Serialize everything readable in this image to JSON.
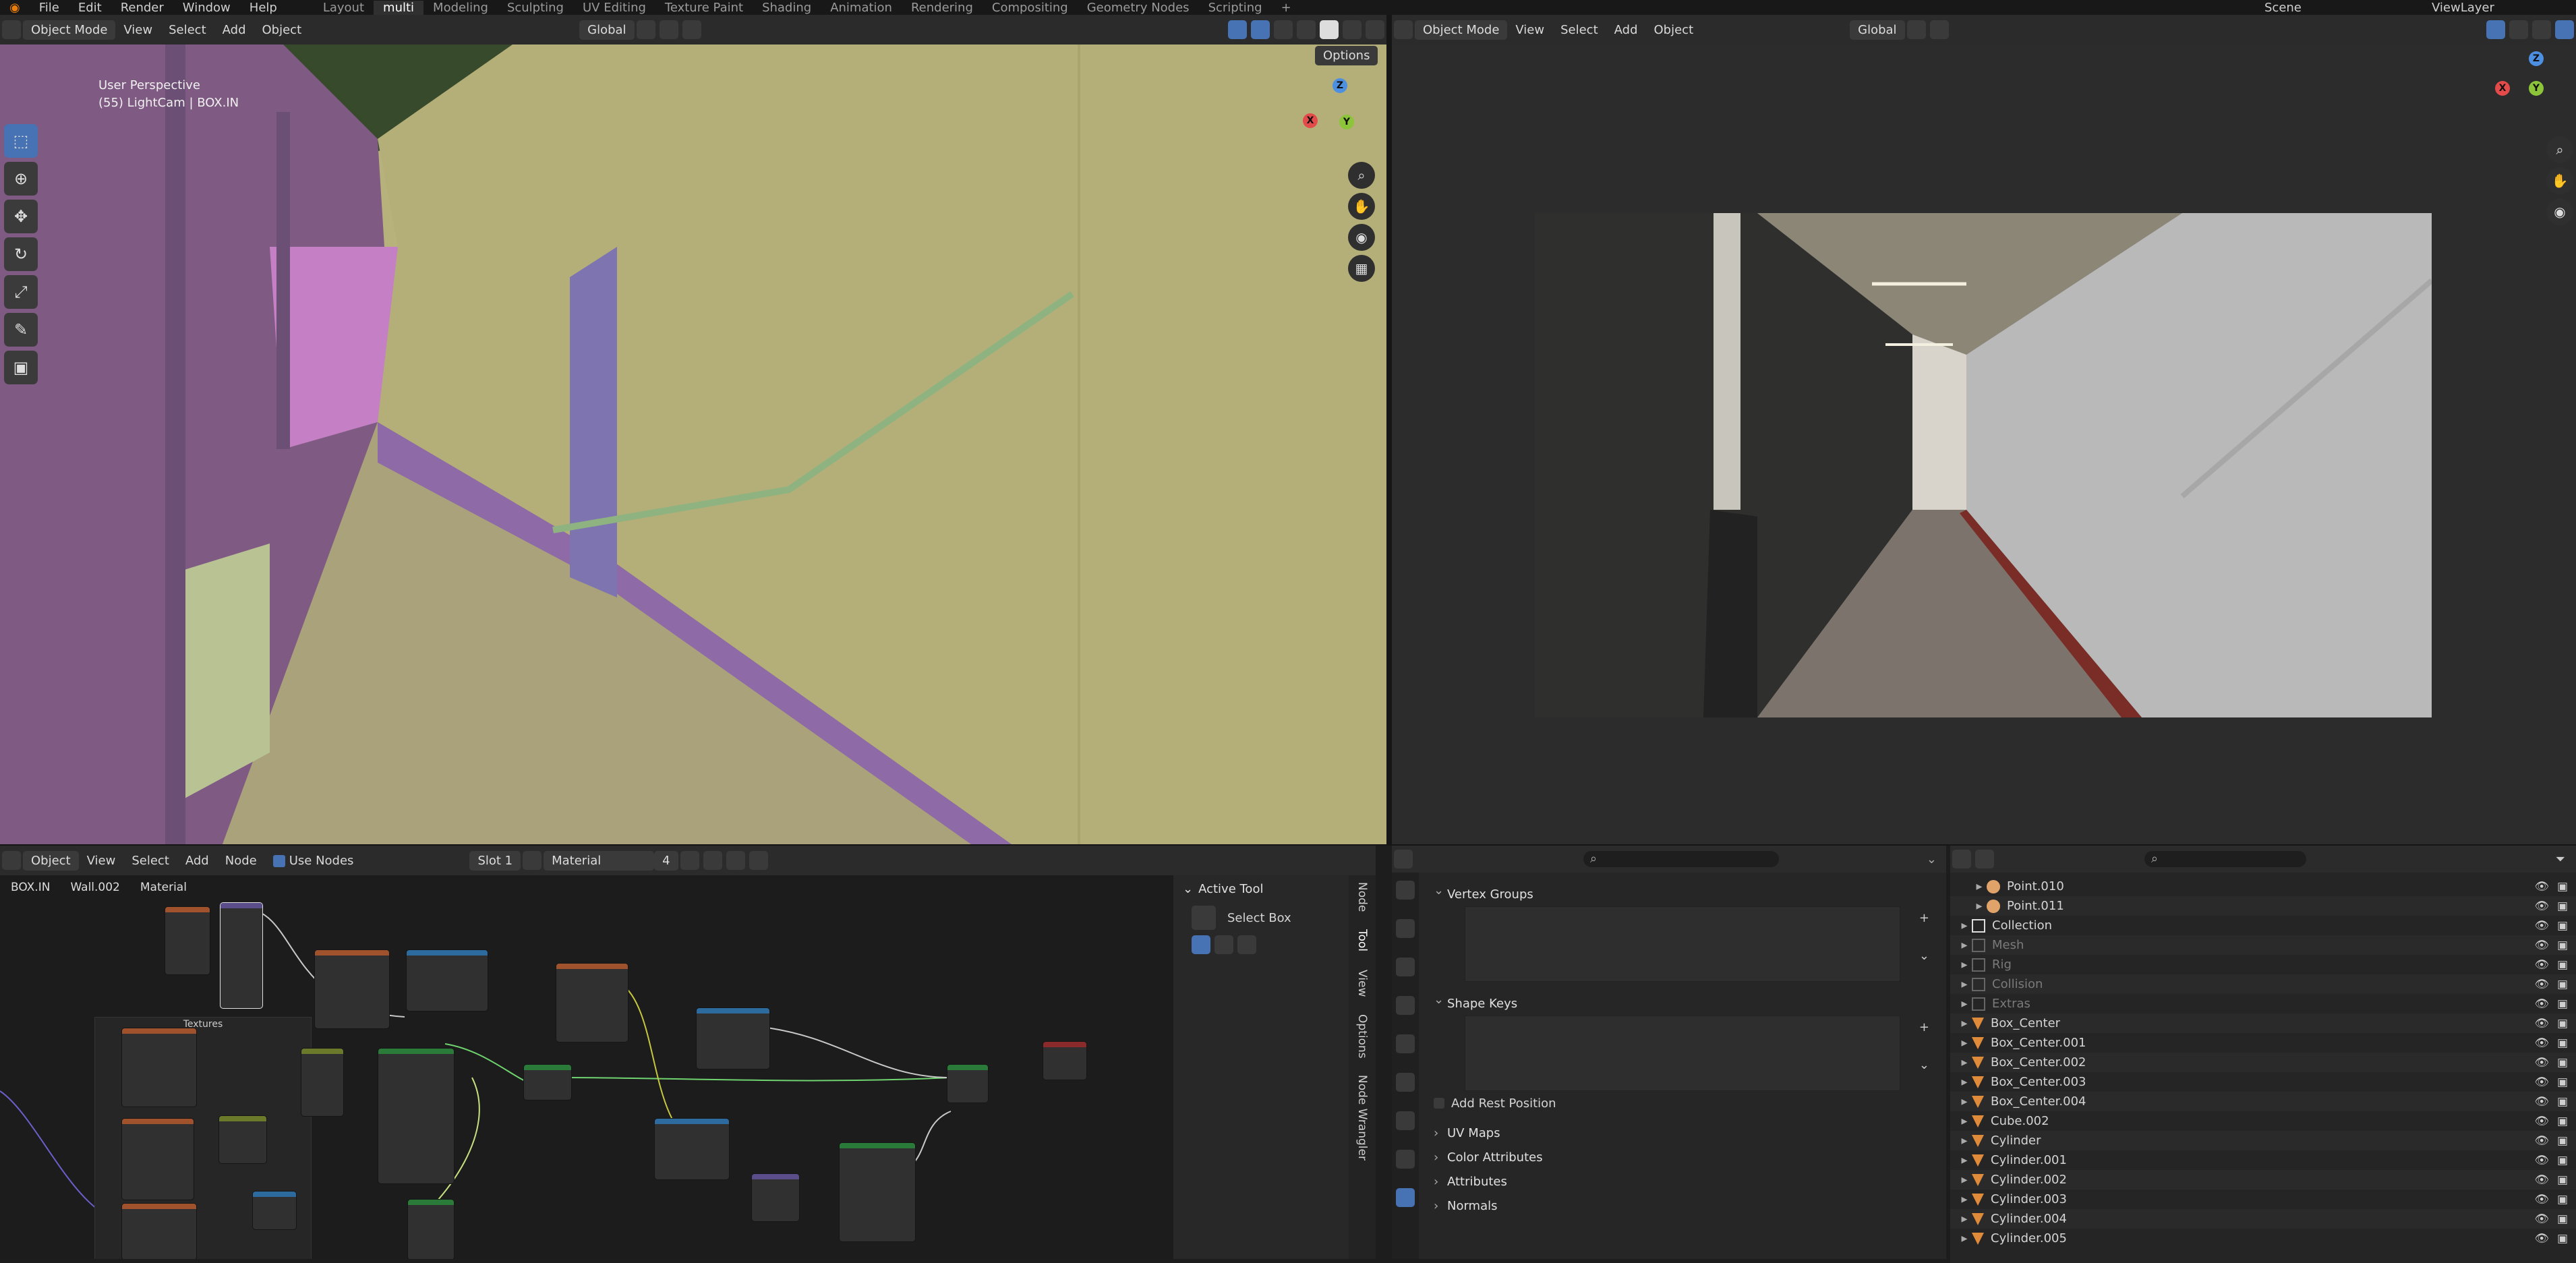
{
  "topbar": {
    "menus": [
      "File",
      "Edit",
      "Render",
      "Window",
      "Help"
    ],
    "workspaces": [
      "Layout",
      "multi",
      "Modeling",
      "Sculpting",
      "UV Editing",
      "Texture Paint",
      "Shading",
      "Animation",
      "Rendering",
      "Compositing",
      "Geometry Nodes",
      "Scripting",
      "+"
    ],
    "active_workspace": "multi",
    "scene": "Scene",
    "view_layer": "ViewLayer"
  },
  "viewport_left": {
    "mode": "Object Mode",
    "menus": [
      "View",
      "Select",
      "Add",
      "Object"
    ],
    "orientation": "Global",
    "options": "Options",
    "overlay_line1": "User Perspective",
    "overlay_line2": "(55) LightCam | BOX.IN",
    "gizmo": {
      "x": "X",
      "y": "Y",
      "z": "Z"
    }
  },
  "viewport_right": {
    "mode": "Object Mode",
    "menus": [
      "View",
      "Select",
      "Add",
      "Object"
    ],
    "orientation": "Global",
    "gizmo": {
      "x": "X",
      "y": "Y",
      "z": "Z"
    }
  },
  "node_editor": {
    "type": "Object",
    "menus": [
      "View",
      "Select",
      "Add",
      "Node"
    ],
    "use_nodes": "Use Nodes",
    "slot": "Slot 1",
    "material": "Material",
    "users": "4",
    "breadcrumb": [
      "BOX.IN",
      "Wall.002",
      "Material"
    ],
    "frame_label": "Textures",
    "active_tool_title": "Active Tool",
    "active_tool_name": "Select Box",
    "side_tabs": [
      "Node",
      "Tool",
      "View",
      "Options",
      "Node Wrangler"
    ]
  },
  "properties": {
    "panels": [
      "Vertex Groups",
      "Shape Keys",
      "Add Rest Position",
      "UV Maps",
      "Color Attributes",
      "Attributes",
      "Normals"
    ]
  },
  "outliner": {
    "rows": [
      {
        "name": "Point.010",
        "kind": "light",
        "indent": 1,
        "muted": false
      },
      {
        "name": "Point.011",
        "kind": "light",
        "indent": 1,
        "muted": false
      },
      {
        "name": "Collection",
        "kind": "collection",
        "indent": 0,
        "muted": false
      },
      {
        "name": "Mesh",
        "kind": "collection",
        "indent": 0,
        "muted": true
      },
      {
        "name": "Rig",
        "kind": "collection",
        "indent": 0,
        "muted": true
      },
      {
        "name": "Collision",
        "kind": "collection",
        "indent": 0,
        "muted": true
      },
      {
        "name": "Extras",
        "kind": "collection",
        "indent": 0,
        "muted": true
      },
      {
        "name": "Box_Center",
        "kind": "mesh",
        "indent": 0,
        "muted": false
      },
      {
        "name": "Box_Center.001",
        "kind": "mesh",
        "indent": 0,
        "muted": false
      },
      {
        "name": "Box_Center.002",
        "kind": "mesh",
        "indent": 0,
        "muted": false
      },
      {
        "name": "Box_Center.003",
        "kind": "mesh",
        "indent": 0,
        "muted": false
      },
      {
        "name": "Box_Center.004",
        "kind": "mesh",
        "indent": 0,
        "muted": false
      },
      {
        "name": "Cube.002",
        "kind": "mesh",
        "indent": 0,
        "muted": false
      },
      {
        "name": "Cylinder",
        "kind": "mesh",
        "indent": 0,
        "muted": false
      },
      {
        "name": "Cylinder.001",
        "kind": "mesh",
        "indent": 0,
        "muted": false
      },
      {
        "name": "Cylinder.002",
        "kind": "mesh",
        "indent": 0,
        "muted": false
      },
      {
        "name": "Cylinder.003",
        "kind": "mesh",
        "indent": 0,
        "muted": false
      },
      {
        "name": "Cylinder.004",
        "kind": "mesh",
        "indent": 0,
        "muted": false
      },
      {
        "name": "Cylinder.005",
        "kind": "mesh",
        "indent": 0,
        "muted": false
      }
    ]
  },
  "colors": {
    "accent": "#4772b3",
    "x_axis": "#e34b4b",
    "y_axis": "#8cc43a",
    "z_axis": "#4d8fe0",
    "object_icon": "#e08b3a",
    "light_icon": "#e0a46a"
  }
}
